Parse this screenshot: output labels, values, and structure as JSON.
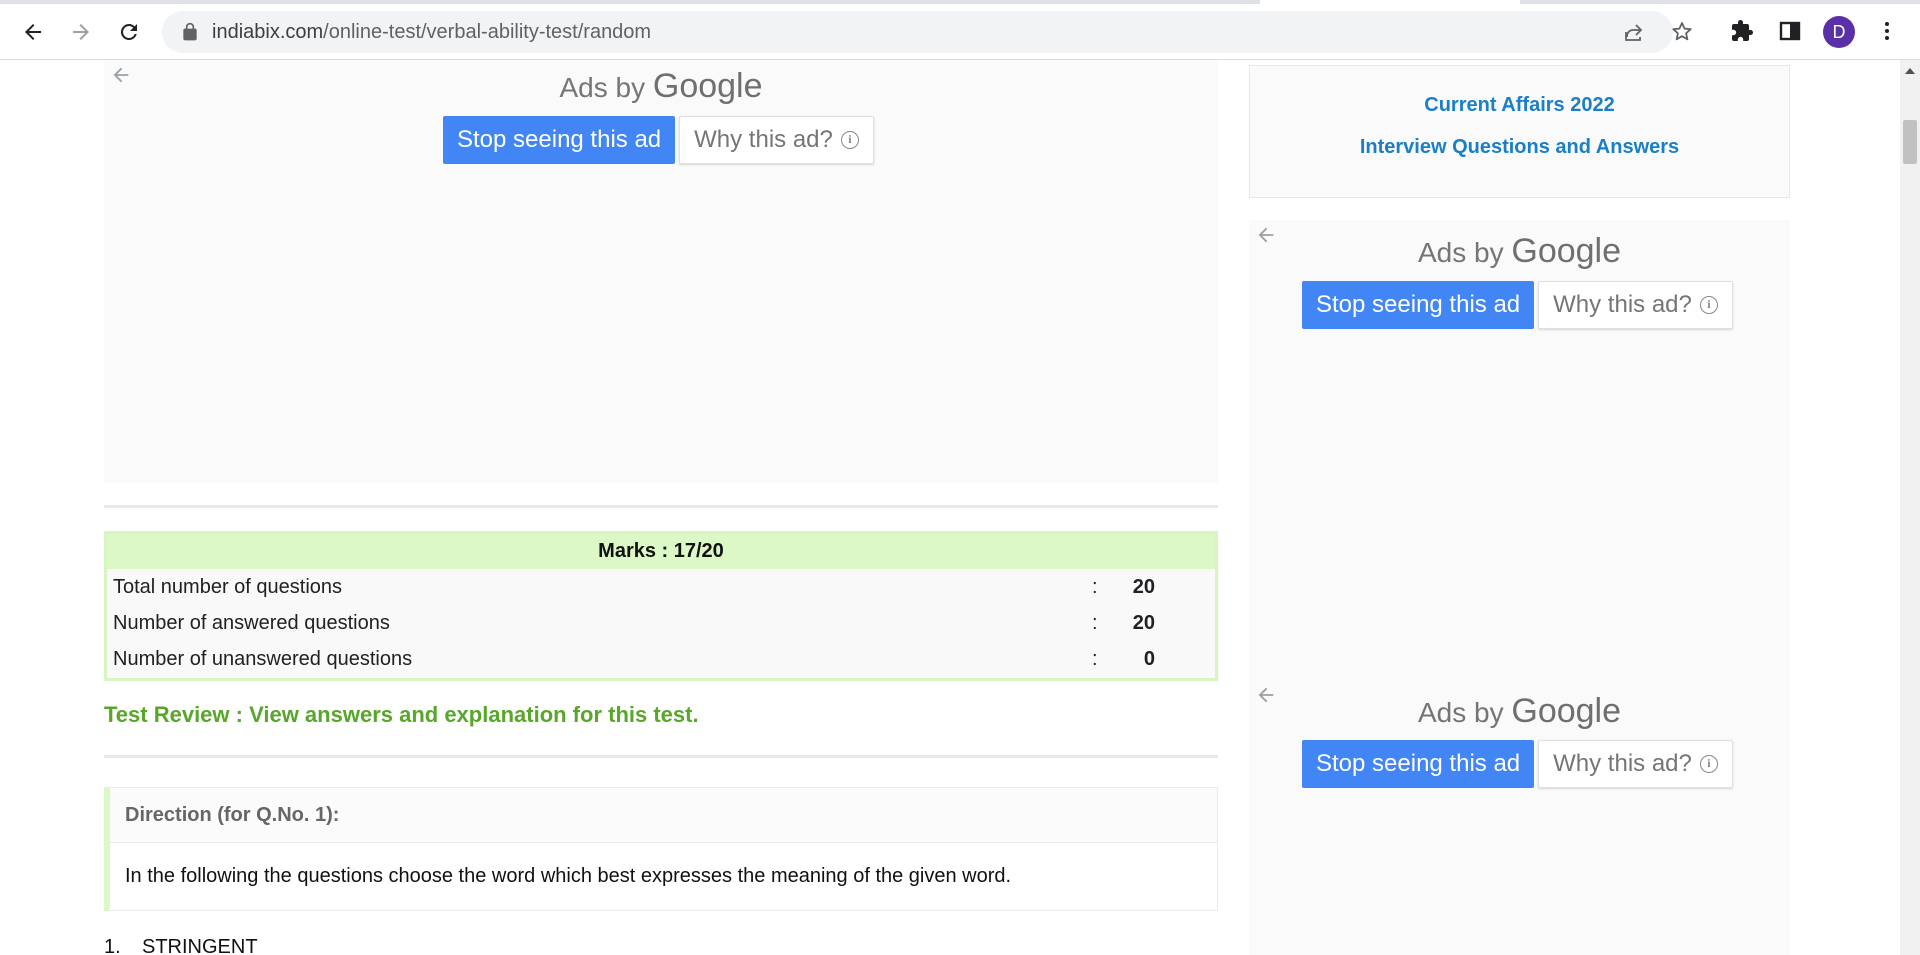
{
  "browser": {
    "url_domain": "indiabix.com",
    "url_path": "/online-test/verbal-ability-test/random",
    "profile_initial": "D"
  },
  "ads": {
    "ads_by_prefix": "Ads by",
    "brand": "Google",
    "stop_label": "Stop seeing this ad",
    "why_label": "Why this ad?",
    "info_glyph": "i"
  },
  "sidebar": {
    "links": [
      "Current Affairs 2022",
      "Interview Questions and Answers"
    ]
  },
  "result": {
    "marks_label": "Marks : 17/20",
    "rows": [
      {
        "label": "Total number of questions",
        "value": "20"
      },
      {
        "label": "Number of answered questions",
        "value": "20"
      },
      {
        "label": "Number of unanswered questions",
        "value": "0"
      }
    ],
    "separator": ":"
  },
  "review": {
    "text": "Test Review : View answers and explanation for this test."
  },
  "direction": {
    "title": "Direction (for Q.No. 1):",
    "body": "In the following the questions choose the word which best expresses the meaning of the given word."
  },
  "question": {
    "number": "1.",
    "word": "STRINGENT"
  },
  "colors": {
    "ad_button_blue": "#4285f4",
    "marks_header_green": "#dcf8c6",
    "review_green": "#58a62a",
    "link_blue": "#1a7fc6"
  }
}
